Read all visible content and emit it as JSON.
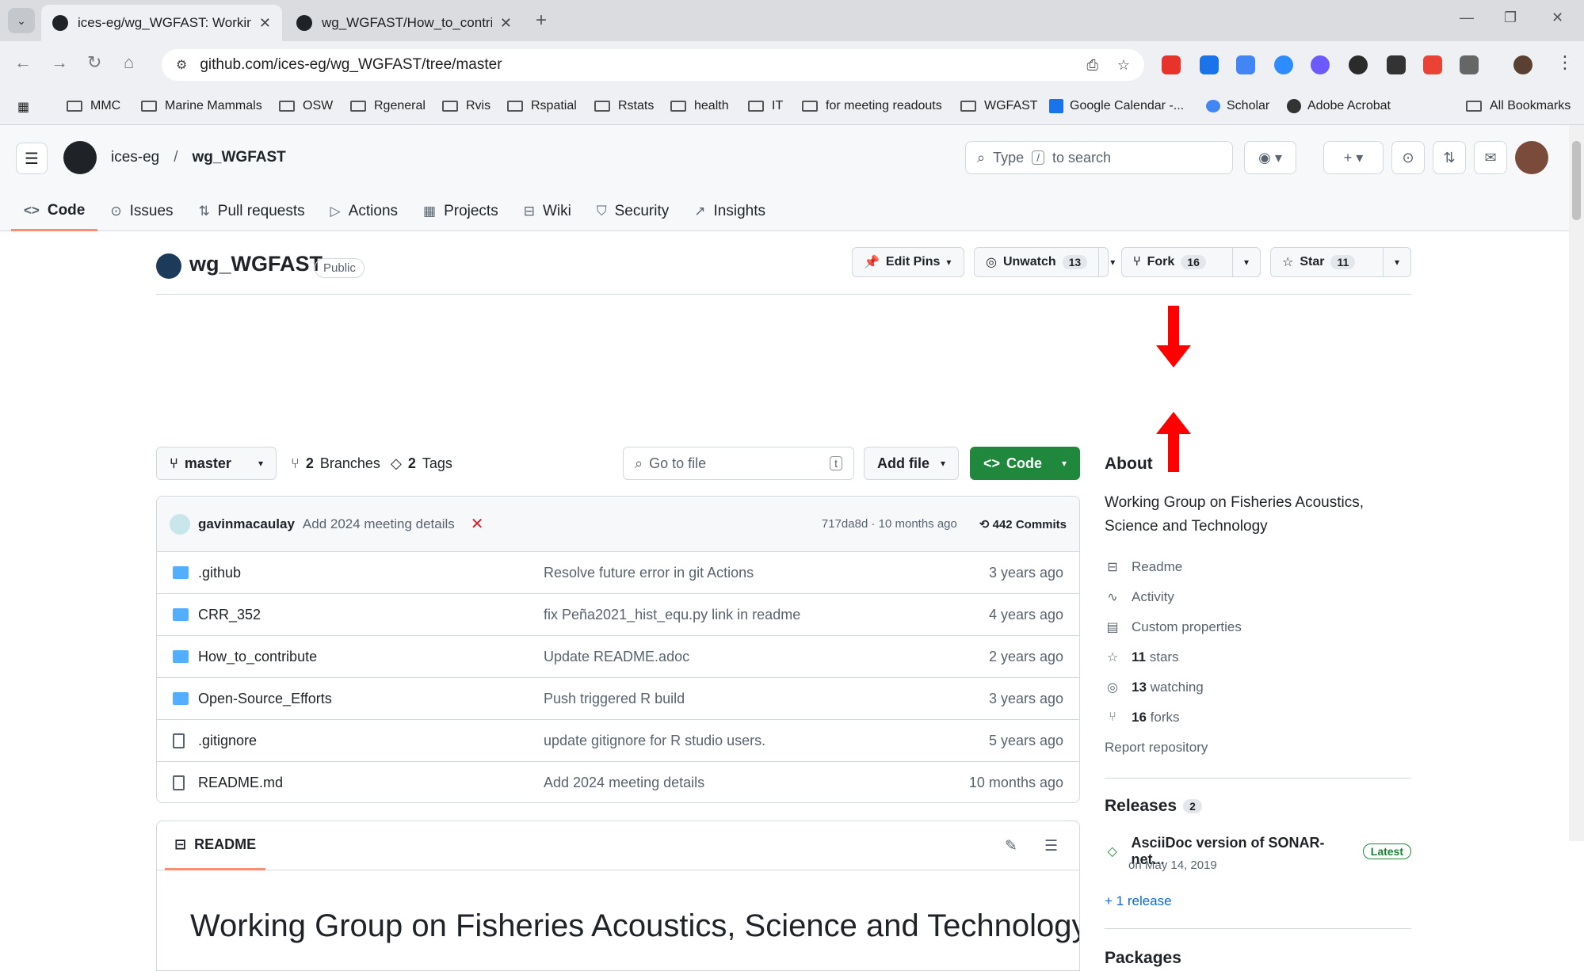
{
  "browser": {
    "tabs": [
      {
        "title": "ices-eg/wg_WGFAST: Working G",
        "active": true
      },
      {
        "title": "wg_WGFAST/How_to_contribute",
        "active": false
      }
    ],
    "url": "github.com/ices-eg/wg_WGFAST/tree/master",
    "bookmarks": [
      "MMC",
      "Marine Mammals",
      "OSW",
      "Rgeneral",
      "Rvis",
      "Rspatial",
      "Rstats",
      "health",
      "IT",
      "for meeting readouts",
      "WGFAST",
      "Google Calendar -...",
      "Scholar",
      "Adobe Acrobat"
    ],
    "all_bookmarks": "All Bookmarks",
    "extension_colors": [
      "#e8332a",
      "#1a73e8",
      "#4285f4",
      "#2d8cff",
      "#6b5bff",
      "#2b2b2b",
      "#333333",
      "#ea4335",
      "#666666"
    ]
  },
  "github": {
    "owner": "ices-eg",
    "separator": "/",
    "repo": "wg_WGFAST",
    "search_prefix": "Type",
    "search_key": "/",
    "search_suffix": "to search",
    "nav": [
      {
        "icon": "<>",
        "label": "Code",
        "selected": true
      },
      {
        "icon": "⊙",
        "label": "Issues"
      },
      {
        "icon": "⇅",
        "label": "Pull requests"
      },
      {
        "icon": "▷",
        "label": "Actions"
      },
      {
        "icon": "▦",
        "label": "Projects"
      },
      {
        "icon": "⊟",
        "label": "Wiki"
      },
      {
        "icon": "⛉",
        "label": "Security"
      },
      {
        "icon": "↗",
        "label": "Insights"
      }
    ]
  },
  "repo_header": {
    "name": "wg_WGFAST",
    "visibility": "Public",
    "edit_pins": "Edit Pins",
    "unwatch": "Unwatch",
    "watch_count": "13",
    "fork": "Fork",
    "fork_count": "16",
    "star": "Star",
    "star_count": "11"
  },
  "toolbar": {
    "branch": "master",
    "branches_count": "2",
    "branches_label": "Branches",
    "tags_count": "2",
    "tags_label": "Tags",
    "goto_placeholder": "Go to file",
    "goto_key": "t",
    "add_file": "Add file",
    "code": "Code"
  },
  "latest_commit": {
    "author": "gavinmacaulay",
    "message": "Add 2024 meeting details",
    "hash_time": "717da8d · 10 months ago",
    "commits": "442 Commits"
  },
  "files": [
    {
      "name": ".github",
      "type": "dir",
      "message": "Resolve future error in git Actions",
      "age": "3 years ago"
    },
    {
      "name": "CRR_352",
      "type": "dir",
      "message": "fix Peña2021_hist_equ.py link in readme",
      "age": "4 years ago"
    },
    {
      "name": "How_to_contribute",
      "type": "dir",
      "message": "Update README.adoc",
      "age": "2 years ago"
    },
    {
      "name": "Open-Source_Efforts",
      "type": "dir",
      "message": "Push triggered R build",
      "age": "3 years ago"
    },
    {
      "name": ".gitignore",
      "type": "file",
      "message": "update gitignore for R studio users.",
      "age": "5 years ago"
    },
    {
      "name": "README.md",
      "type": "file",
      "message": "Add 2024 meeting details",
      "age": "10 months ago"
    }
  ],
  "readme": {
    "tab": "README",
    "heading": "Working Group on Fisheries Acoustics, Science and Technology"
  },
  "about": {
    "title": "About",
    "description": "Working Group on Fisheries Acoustics, Science and Technology",
    "readme": "Readme",
    "activity": "Activity",
    "custom_properties": "Custom properties",
    "stars_count": "11",
    "stars_label": "stars",
    "watching_count": "13",
    "watching_label": "watching",
    "forks_count": "16",
    "forks_label": "forks",
    "report": "Report repository",
    "releases_title": "Releases",
    "releases_count": "2",
    "release_name": "AsciiDoc version of SONAR-net...",
    "release_badge": "Latest",
    "release_date": "on May 14, 2019",
    "more_releases": "+ 1 release",
    "packages_title": "Packages"
  }
}
